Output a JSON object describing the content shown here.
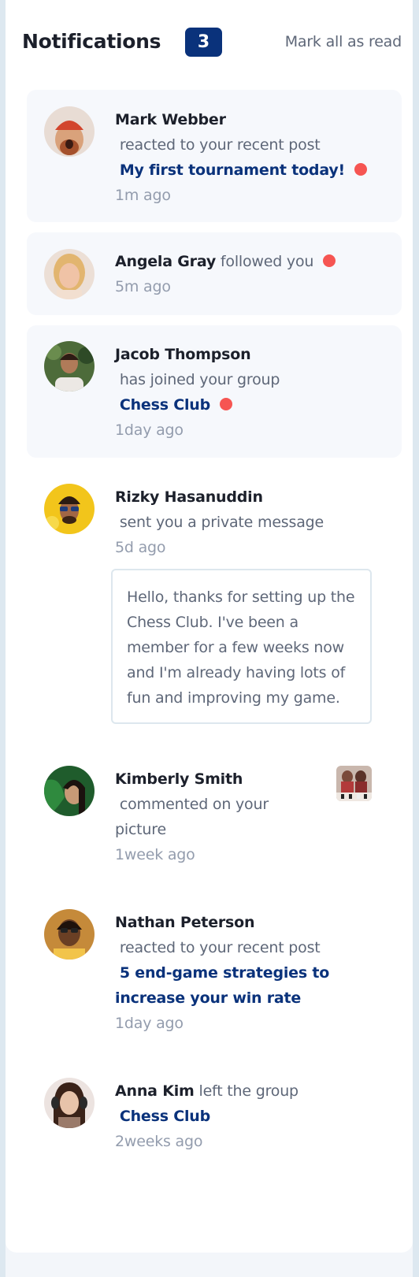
{
  "header": {
    "title": "Notifications",
    "count": "3",
    "mark_all": "Mark all as read"
  },
  "notifications": [
    {
      "name": "Mark Webber",
      "action": "reacted to your recent post",
      "target": "My first tournament today!",
      "time": "1m ago",
      "unread": true
    },
    {
      "name": "Angela Gray",
      "action": "followed you",
      "time": "5m ago",
      "unread": true
    },
    {
      "name": "Jacob Thompson",
      "action": "has joined your group",
      "target": "Chess Club",
      "time": "1day ago",
      "unread": true
    },
    {
      "name": "Rizky Hasanuddin",
      "action": "sent you a private message",
      "time": "5d ago",
      "message": "Hello, thanks for setting up the Chess Club. I've been a member for a few weeks now and I'm already having lots of fun and improving my game.",
      "unread": false
    },
    {
      "name": "Kimberly Smith",
      "action": "commented on your",
      "action_2": "picture",
      "time": "1week ago",
      "unread": false
    },
    {
      "name": "Nathan Peterson",
      "action": "reacted to your recent post",
      "target": "5 end-game strategies to",
      "target_2": "increase your win rate",
      "time": "1day ago",
      "unread": false
    },
    {
      "name": "Anna Kim",
      "action": "left the group",
      "target": "Chess Club",
      "time": "2weeks ago",
      "unread": false
    }
  ],
  "colors": {
    "badge": "#0a327b",
    "unread_dot": "#f65552",
    "name": "#1c202b",
    "link": "#0a327b",
    "text": "#5e6778",
    "time": "#939cad",
    "unread_bg": "#f6f8fc"
  }
}
